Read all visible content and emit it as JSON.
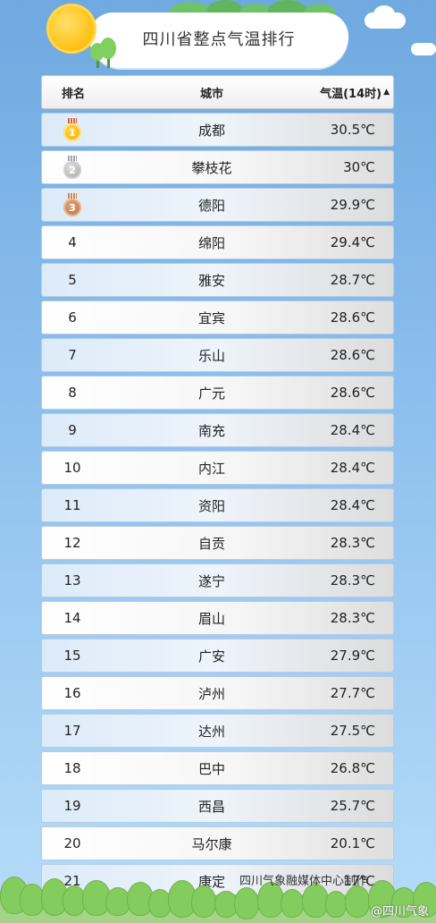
{
  "header": {
    "title": "四川省整点气温排行"
  },
  "table": {
    "columns": {
      "rank": "排名",
      "city": "城市",
      "temp": "气温(14时)",
      "sort_icon": "caret-up-icon"
    },
    "rows": [
      {
        "rank": "1",
        "city": "成都",
        "temp": "30.5℃",
        "medal": "gold"
      },
      {
        "rank": "2",
        "city": "攀枝花",
        "temp": "30℃",
        "medal": "silver"
      },
      {
        "rank": "3",
        "city": "德阳",
        "temp": "29.9℃",
        "medal": "bronze"
      },
      {
        "rank": "4",
        "city": "绵阳",
        "temp": "29.4℃"
      },
      {
        "rank": "5",
        "city": "雅安",
        "temp": "28.7℃"
      },
      {
        "rank": "6",
        "city": "宜宾",
        "temp": "28.6℃"
      },
      {
        "rank": "7",
        "city": "乐山",
        "temp": "28.6℃"
      },
      {
        "rank": "8",
        "city": "广元",
        "temp": "28.6℃"
      },
      {
        "rank": "9",
        "city": "南充",
        "temp": "28.4℃"
      },
      {
        "rank": "10",
        "city": "内江",
        "temp": "28.4℃"
      },
      {
        "rank": "11",
        "city": "资阳",
        "temp": "28.4℃"
      },
      {
        "rank": "12",
        "city": "自贡",
        "temp": "28.3℃"
      },
      {
        "rank": "13",
        "city": "遂宁",
        "temp": "28.3℃"
      },
      {
        "rank": "14",
        "city": "眉山",
        "temp": "28.3℃"
      },
      {
        "rank": "15",
        "city": "广安",
        "temp": "27.9℃"
      },
      {
        "rank": "16",
        "city": "泸州",
        "temp": "27.7℃"
      },
      {
        "rank": "17",
        "city": "达州",
        "temp": "27.5℃"
      },
      {
        "rank": "18",
        "city": "巴中",
        "temp": "26.8℃"
      },
      {
        "rank": "19",
        "city": "西昌",
        "temp": "25.7℃"
      },
      {
        "rank": "20",
        "city": "马尔康",
        "temp": "20.1℃"
      },
      {
        "rank": "21",
        "city": "康定",
        "temp": "17℃"
      }
    ]
  },
  "footer": {
    "credit": "四川气象融媒体中心制作",
    "watermark": "@四川气象"
  },
  "colors": {
    "sky_top": "#6fa9e0",
    "sky_bottom": "#b6dcf8",
    "gold": "#f0a400",
    "silver": "#9a9a9a",
    "bronze": "#b56a3b"
  }
}
